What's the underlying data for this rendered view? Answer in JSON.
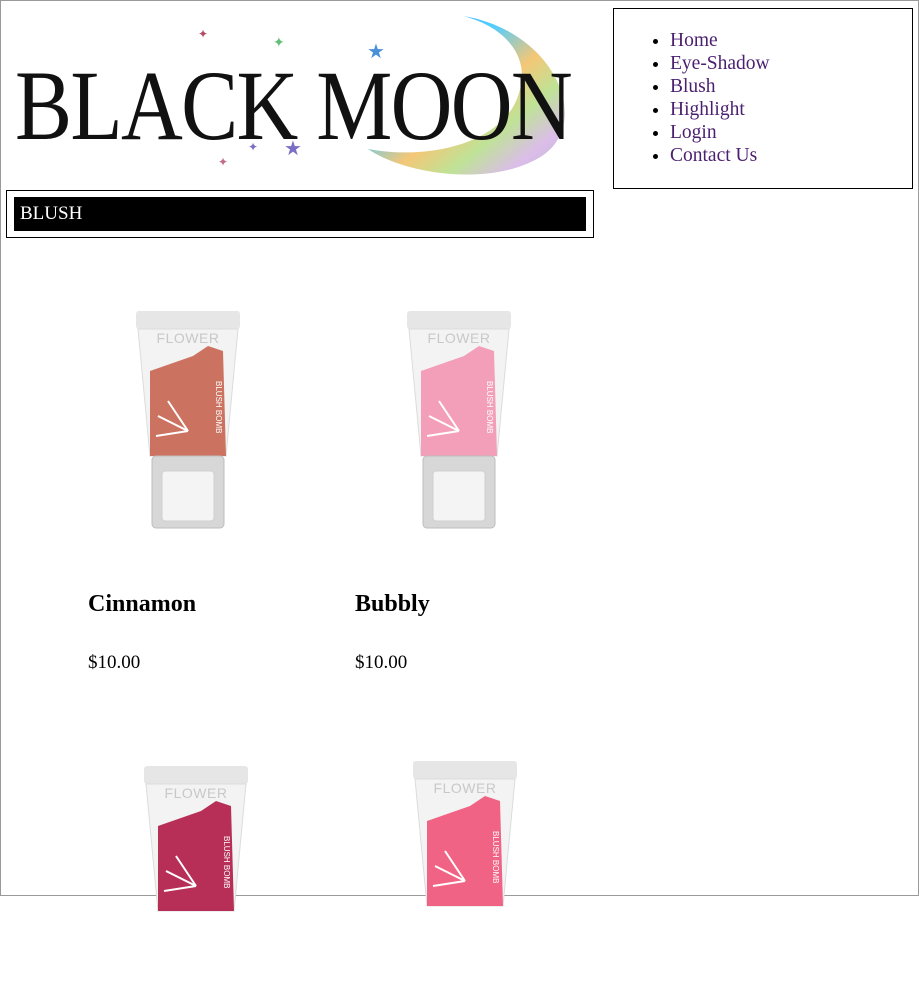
{
  "brand": {
    "logo_text": "BLACK MOON"
  },
  "nav": {
    "items": [
      {
        "label": "Home"
      },
      {
        "label": "Eye-Shadow"
      },
      {
        "label": "Blush"
      },
      {
        "label": "Highlight"
      },
      {
        "label": "Login"
      },
      {
        "label": "Contact Us"
      }
    ]
  },
  "category": {
    "title": "BLUSH"
  },
  "products": [
    {
      "name": "Cinnamon",
      "price": "$10.00",
      "package_brand": "FLOWER",
      "package_label": "BLUSH BOMB",
      "color": "#c96a57"
    },
    {
      "name": "Bubbly",
      "price": "$10.00",
      "package_brand": "FLOWER",
      "package_label": "BLUSH BOMB",
      "color": "#f29ab5"
    },
    {
      "name": "",
      "price": "",
      "package_brand": "FLOWER",
      "package_label": "BLUSH BOMB",
      "color": "#b3244e"
    },
    {
      "name": "",
      "price": "",
      "package_brand": "FLOWER",
      "package_label": "BLUSH BOMB",
      "color": "#f05b7e"
    }
  ],
  "colors": {
    "nav_link": "#4b1f6f",
    "category_bar_bg": "#000000",
    "category_bar_text": "#ffffff"
  }
}
